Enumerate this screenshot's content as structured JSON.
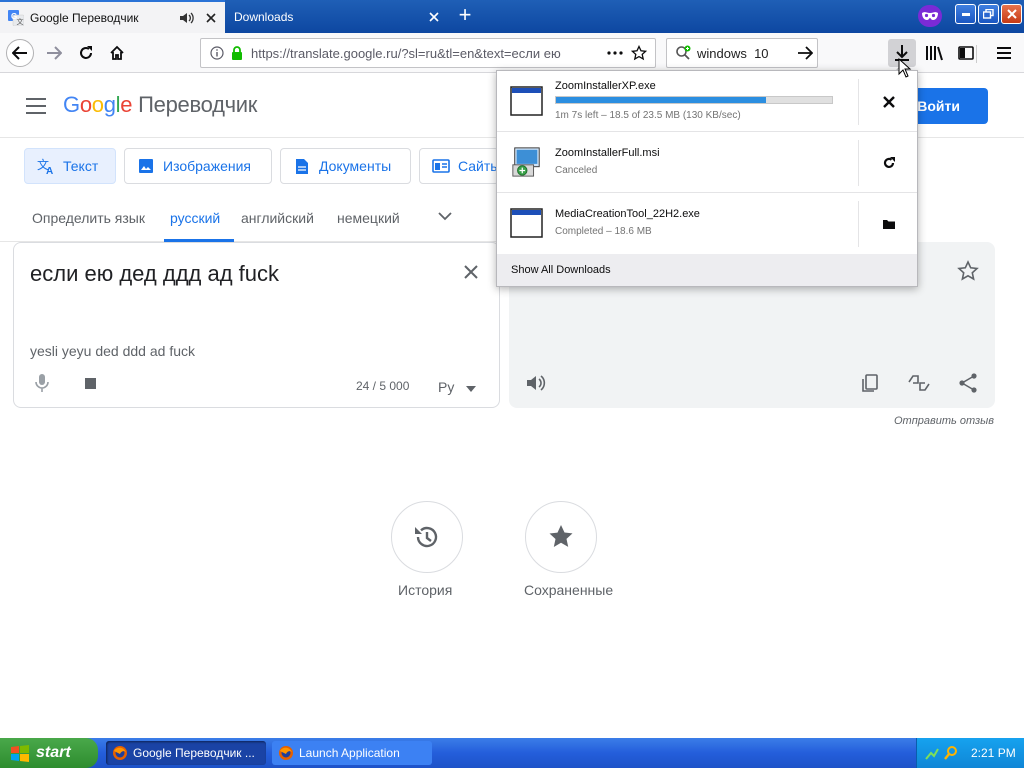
{
  "browser": {
    "tabs": [
      {
        "title": "Google Переводчик",
        "active": true
      },
      {
        "title": "Downloads",
        "active": false
      }
    ],
    "url": "https://translate.google.ru/?sl=ru&tl=en&text=если ею",
    "search_value": "windows  10"
  },
  "gt": {
    "logo_google": "Google",
    "logo_product": "Переводчик",
    "signin_label": "Войти",
    "modes": [
      "Текст",
      "Изображения",
      "Документы",
      "Сайты"
    ],
    "langs": [
      "Определить язык",
      "русский",
      "английский",
      "немецкий"
    ],
    "source_text": "если ею дед ддд ад fuck",
    "transliteration": "yesli yeyu ded ddd ad fuck",
    "char_count": "24 / 5 000",
    "keyboard_label": "Рy",
    "feedback": "Отправить отзыв",
    "history_label": "История",
    "saved_label": "Сохраненные"
  },
  "downloads": {
    "items": [
      {
        "name": "ZoomInstallerXP.exe",
        "status": "1m 7s left – 18.5 of 23.5 MB (130 KB/sec)",
        "progress": 0.76,
        "action": "cancel-icon"
      },
      {
        "name": "ZoomInstallerFull.msi",
        "status": "Canceled",
        "action": "retry-icon"
      },
      {
        "name": "MediaCreationTool_22H2.exe",
        "status": "Completed – 18.6 MB",
        "action": "folder-icon"
      }
    ],
    "footer": "Show All Downloads"
  },
  "taskbar": {
    "start_label": "start",
    "tasks": [
      "Google Переводчик ...",
      "Launch Application"
    ],
    "clock": "2:21 PM"
  },
  "colors": {
    "accent": "#1a73e8",
    "progress": "#2c8ee0",
    "xp_blue": "#245edb",
    "xp_start": "#2e8d2f"
  }
}
